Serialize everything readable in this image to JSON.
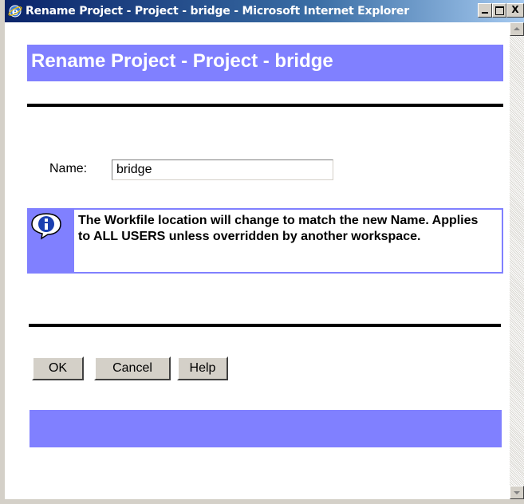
{
  "window": {
    "title": "Rename Project - Project - bridge - Microsoft Internet Explorer",
    "controls": {
      "minimize": "_",
      "maximize": "□",
      "close": "X"
    }
  },
  "page": {
    "heading": "Rename Project - Project - bridge",
    "name_label": "Name:",
    "name_value": "bridge",
    "info_icon": "info-icon",
    "info_message": "The Workfile location will change to match the new Name. Applies to ALL USERS unless overridden by another workspace.",
    "buttons": {
      "ok": "OK",
      "cancel": "Cancel",
      "help": "Help"
    }
  },
  "colors": {
    "band": "#8080ff",
    "titlebar_start": "#0a246a",
    "titlebar_end": "#a6caf0"
  }
}
